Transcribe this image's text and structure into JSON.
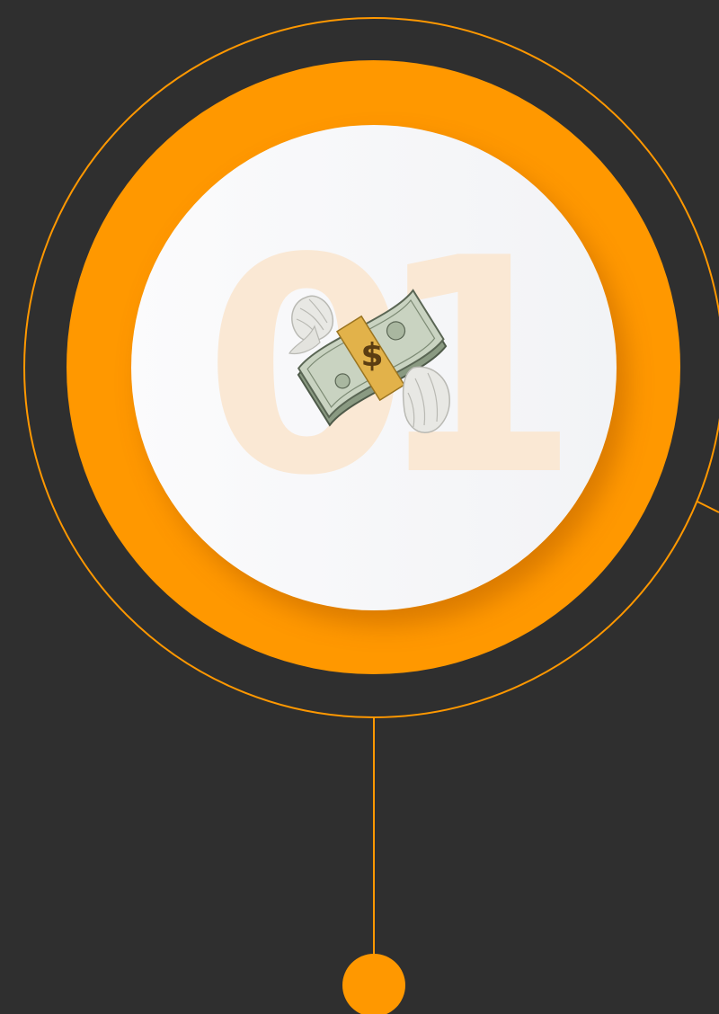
{
  "step": {
    "number": "01",
    "icon": "flying-money-icon"
  },
  "colors": {
    "background": "#2f2f2f",
    "accent": "#ff9800",
    "disc": "#f6f7f9",
    "number_watermark": "#fae8d4"
  }
}
